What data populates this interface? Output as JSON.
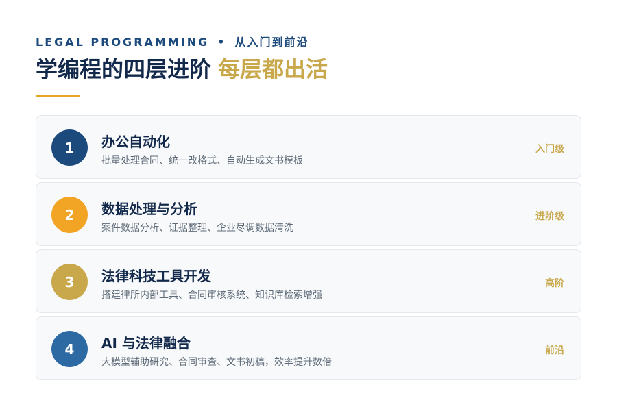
{
  "header": {
    "eyebrow_en": "LEGAL PROGRAMMING",
    "eyebrow_sep": "•",
    "eyebrow_cn": "从入门到前沿",
    "title_main": "学编程的四层进阶",
    "title_accent": "每层都出活"
  },
  "colors": {
    "navy": "#13294b",
    "gold": "#c9a84c",
    "orange": "#f2a424",
    "blue_dark": "#1d4a7c",
    "blue_mid": "#2d6aa3"
  },
  "levels": [
    {
      "number": "1",
      "name": "办公自动化",
      "desc": "批量处理合同、统一改格式、自动生成文书模板",
      "tag": "入门级",
      "color": "#1d4a7c"
    },
    {
      "number": "2",
      "name": "数据处理与分析",
      "desc": "案件数据分析、证据整理、企业尽调数据清洗",
      "tag": "进阶级",
      "color": "#f2a424"
    },
    {
      "number": "3",
      "name": "法律科技工具开发",
      "desc": "搭建律所内部工具、合同审核系统、知识库检索增强",
      "tag": "高阶",
      "color": "#c9a84c"
    },
    {
      "number": "4",
      "name": "AI 与法律融合",
      "desc": "大模型辅助研究、合同审查、文书初稿，效率提升数倍",
      "tag": "前沿",
      "color": "#2d6aa3"
    }
  ]
}
